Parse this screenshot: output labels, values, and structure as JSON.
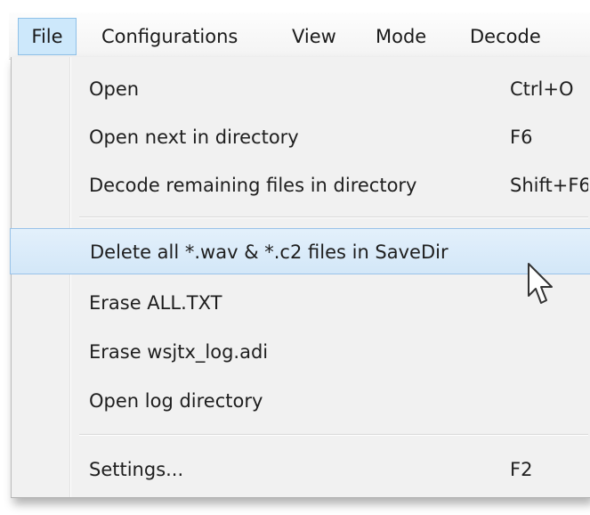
{
  "menubar": {
    "items": [
      {
        "label": "File",
        "active": true
      },
      {
        "label": "Configurations"
      },
      {
        "label": "View"
      },
      {
        "label": "Mode"
      },
      {
        "label": "Decode"
      }
    ]
  },
  "file_menu": {
    "items": [
      {
        "label": "Open",
        "shortcut": "Ctrl+O"
      },
      {
        "label": "Open next in directory",
        "shortcut": "F6"
      },
      {
        "label": "Decode remaining files in directory",
        "shortcut": "Shift+F6"
      },
      {
        "label": "Delete all *.wav & *.c2 files in SaveDir",
        "shortcut": "",
        "highlighted": true
      },
      {
        "label": "Erase ALL.TXT",
        "shortcut": ""
      },
      {
        "label": "Erase wsjtx_log.adi",
        "shortcut": ""
      },
      {
        "label": "Open log directory",
        "shortcut": ""
      },
      {
        "label": "Settings...",
        "shortcut": "F2"
      }
    ]
  },
  "colors": {
    "highlight": "#d3e7f8",
    "highlight_border": "#99c3e9",
    "menu_background": "#f1f1f1"
  },
  "icons": {
    "cursor": "mouse-pointer-icon"
  }
}
